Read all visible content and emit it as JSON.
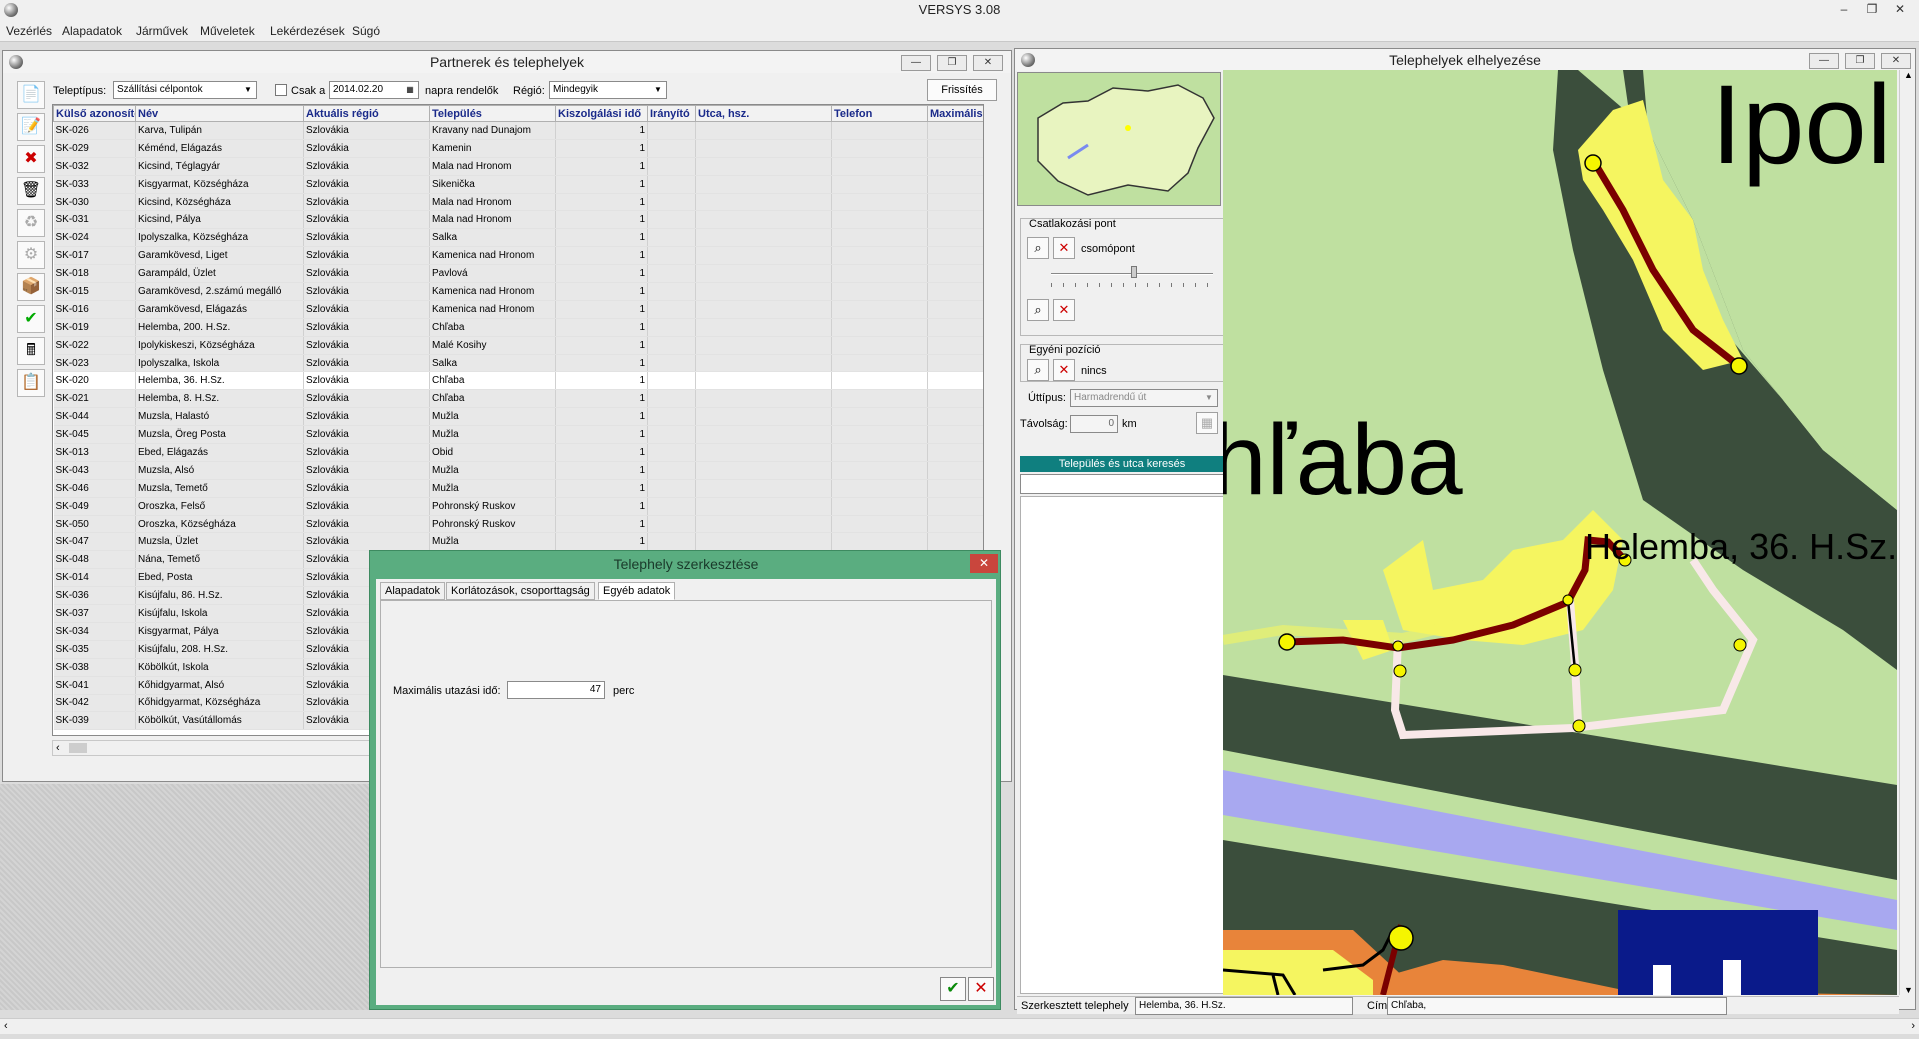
{
  "app": {
    "title": "VERSYS 3.08"
  },
  "menu": [
    "Vezérlés",
    "Alapadatok",
    "Járművek",
    "Műveletek",
    "Lekérdezések",
    "Súgó"
  ],
  "partners_window": {
    "title": "Partnerek és telephelyek",
    "filters": {
      "type_label": "Teleptípus:",
      "type_value": "Szállítási célpontok",
      "only_label": "Csak a",
      "date_value": "2014.02.20",
      "date_suffix": "napra rendelők",
      "region_label": "Régió:",
      "region_value": "Mindegyik",
      "refresh_label": "Frissítés"
    },
    "columns": [
      "Külső azonosító",
      "Név",
      "Aktuális régió",
      "Település",
      "Kiszolgálási idő",
      "Irányító",
      "Utca, hsz.",
      "Telefon",
      "Maximális"
    ],
    "rows": [
      [
        "SK-026",
        "Karva, Tulipán",
        "Szlovákia",
        "Kravany nad Dunajom",
        "1"
      ],
      [
        "SK-029",
        "Kéménd, Elágazás",
        "Szlovákia",
        "Kamenin",
        "1"
      ],
      [
        "SK-032",
        "Kicsind, Téglagyár",
        "Szlovákia",
        "Mala nad Hronom",
        "1"
      ],
      [
        "SK-033",
        "Kisgyarmat, Községháza",
        "Szlovákia",
        "Sikenička",
        "1"
      ],
      [
        "SK-030",
        "Kicsind, Községháza",
        "Szlovákia",
        "Mala nad Hronom",
        "1"
      ],
      [
        "SK-031",
        "Kicsind, Pálya",
        "Szlovákia",
        "Mala nad Hronom",
        "1"
      ],
      [
        "SK-024",
        "Ipolyszalka, Községháza",
        "Szlovákia",
        "Salka",
        "1"
      ],
      [
        "SK-017",
        "Garamkövesd, Liget",
        "Szlovákia",
        "Kamenica nad Hronom",
        "1"
      ],
      [
        "SK-018",
        "Garampáld, Üzlet",
        "Szlovákia",
        "Pavlová",
        "1"
      ],
      [
        "SK-015",
        "Garamkövesd, 2.számú megálló",
        "Szlovákia",
        "Kamenica nad Hronom",
        "1"
      ],
      [
        "SK-016",
        "Garamkövesd, Elágazás",
        "Szlovákia",
        "Kamenica nad Hronom",
        "1"
      ],
      [
        "SK-019",
        "Helemba, 200. H.Sz.",
        "Szlovákia",
        "Chľaba",
        "1"
      ],
      [
        "SK-022",
        "Ipolykiskeszi, Községháza",
        "Szlovákia",
        "Malé Kosihy",
        "1"
      ],
      [
        "SK-023",
        "Ipolyszalka, Iskola",
        "Szlovákia",
        "Salka",
        "1"
      ],
      [
        "SK-020",
        "Helemba, 36. H.Sz.",
        "Szlovákia",
        "Chľaba",
        "1"
      ],
      [
        "SK-021",
        "Helemba, 8. H.Sz.",
        "Szlovákia",
        "Chľaba",
        "1"
      ],
      [
        "SK-044",
        "Muzsla, Halastó",
        "Szlovákia",
        "Mužla",
        "1"
      ],
      [
        "SK-045",
        "Muzsla, Öreg Posta",
        "Szlovákia",
        "Mužla",
        "1"
      ],
      [
        "SK-013",
        "Ebed, Elágazás",
        "Szlovákia",
        "Obid",
        "1"
      ],
      [
        "SK-043",
        "Muzsla, Alsó",
        "Szlovákia",
        "Mužla",
        "1"
      ],
      [
        "SK-046",
        "Muzsla, Temető",
        "Szlovákia",
        "Mužla",
        "1"
      ],
      [
        "SK-049",
        "Oroszka, Felső",
        "Szlovákia",
        "Pohronský Ruskov",
        "1"
      ],
      [
        "SK-050",
        "Oroszka, Községháza",
        "Szlovákia",
        "Pohronský Ruskov",
        "1"
      ],
      [
        "SK-047",
        "Muzsla, Üzlet",
        "Szlovákia",
        "Mužla",
        "1"
      ],
      [
        "SK-048",
        "Nána, Temető",
        "Szlovákia",
        "",
        ""
      ],
      [
        "SK-014",
        "Ebed, Posta",
        "Szlovákia",
        "",
        ""
      ],
      [
        "SK-036",
        "Kisújfalu, 86. H.Sz.",
        "Szlovákia",
        "",
        ""
      ],
      [
        "SK-037",
        "Kisújfalu, Iskola",
        "Szlovákia",
        "",
        ""
      ],
      [
        "SK-034",
        "Kisgyarmat, Pálya",
        "Szlovákia",
        "",
        ""
      ],
      [
        "SK-035",
        "Kisújfalu, 208. H.Sz.",
        "Szlovákia",
        "",
        ""
      ],
      [
        "SK-038",
        "Köbölkút, Iskola",
        "Szlovákia",
        "",
        ""
      ],
      [
        "SK-041",
        "Kőhidgyarmat, Alsó",
        "Szlovákia",
        "",
        ""
      ],
      [
        "SK-042",
        "Kőhidgyarmat, Községháza",
        "Szlovákia",
        "",
        ""
      ],
      [
        "SK-039",
        "Köbölkút, Vasútállomás",
        "Szlovákia",
        "",
        ""
      ]
    ]
  },
  "edit_dialog": {
    "title": "Telephely szerkesztése",
    "tabs": [
      "Alapadatok",
      "Korlátozások, csoporttagság",
      "Egyéb adatok"
    ],
    "max_travel_label": "Maximális utazási idő:",
    "max_travel_value": "47",
    "max_travel_unit": "perc"
  },
  "location_window": {
    "title": "Telephelyek elhelyezése",
    "connection_group": "Csatlakozási pont",
    "node_label": "csomópont",
    "own_position_group": "Egyéni pozíció",
    "own_position_value": "nincs",
    "road_type_label": "Úttípus:",
    "road_type_value": "Harmadrendű út",
    "distance_label": "Távolság:",
    "distance_value": "0",
    "distance_unit": "km",
    "search_header": "Település és utca keresés",
    "map_labels": {
      "town_top": "Ipol",
      "town_mid": "hľaba",
      "site": "Helemba, 36. H.Sz."
    },
    "status_site_label": "Szerkesztett telephely",
    "status_site_value": "Helemba, 36. H.Sz.",
    "status_address_label": "Cím:",
    "status_address_value": "Chľaba,"
  },
  "colors": {
    "selected_row": "#ffffff",
    "dialog_frame": "#5aad80",
    "search_header": "#0f7f7f",
    "map_grass": "#bfe0a0",
    "map_forest": "#3b4e3c",
    "map_river": "#a8a8f0",
    "route": "#7a0000"
  }
}
